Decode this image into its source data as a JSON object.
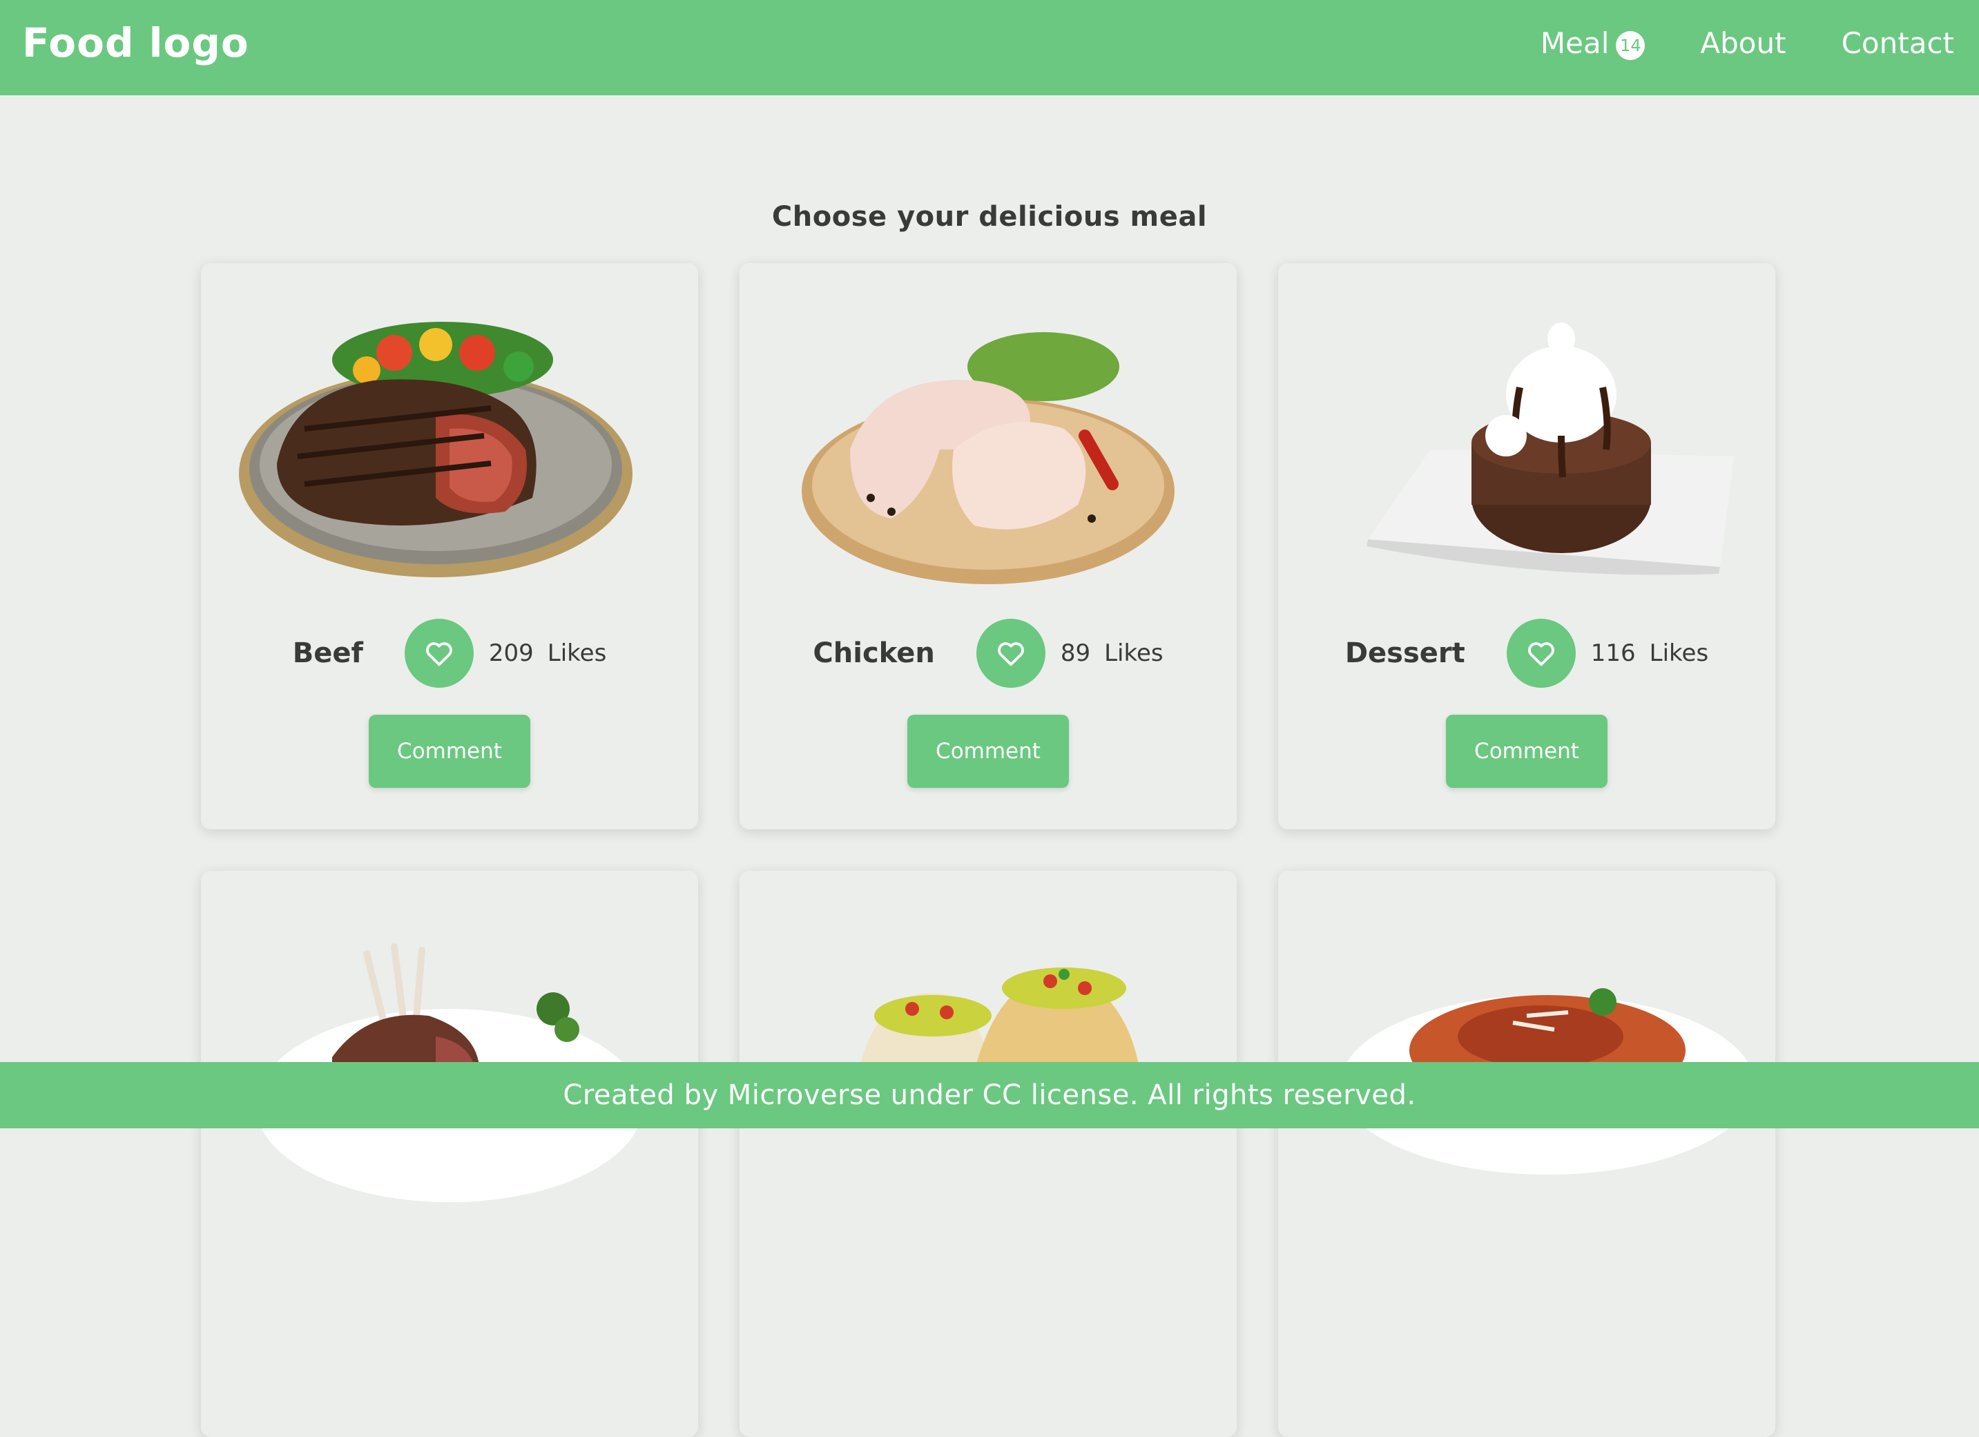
{
  "header": {
    "logo": "Food logo",
    "nav": [
      {
        "label": "Meal",
        "badge": "14"
      },
      {
        "label": "About"
      },
      {
        "label": "Contact"
      }
    ]
  },
  "main": {
    "title": "Choose your delicious meal",
    "cards": [
      {
        "name": "Beef",
        "likes": "209",
        "likes_label": "Likes",
        "comment_label": "Comment",
        "image_subject": "grilled-steak-plate"
      },
      {
        "name": "Chicken",
        "likes": "89",
        "likes_label": "Likes",
        "comment_label": "Comment",
        "image_subject": "raw-chicken-legs-board"
      },
      {
        "name": "Dessert",
        "likes": "116",
        "likes_label": "Likes",
        "comment_label": "Comment",
        "image_subject": "chocolate-cake-ice-cream"
      },
      {
        "image_subject": "lamb-rack-plate"
      },
      {
        "image_subject": "tacos"
      },
      {
        "image_subject": "pasta-plate"
      }
    ]
  },
  "footer": {
    "text": "Created by Microverse under CC license. All rights reserved."
  },
  "colors": {
    "accent": "#6ac880",
    "background": "#eceeeb",
    "text": "#3a3a3a",
    "header_text": "#ffffff"
  },
  "icons": {
    "like": "heart-icon"
  }
}
